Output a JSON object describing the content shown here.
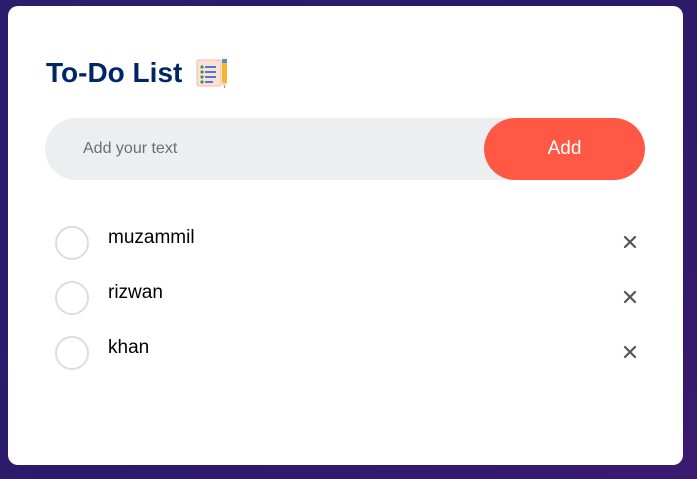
{
  "header": {
    "title": "To-Do List",
    "title_icon": "notepad-pencil-icon"
  },
  "input": {
    "placeholder": "Add your text",
    "value": ""
  },
  "add_button": {
    "label": "Add"
  },
  "tasks": [
    {
      "text": "muzammil",
      "checked": false
    },
    {
      "text": "rizwan",
      "checked": false
    },
    {
      "text": "khan",
      "checked": false
    }
  ],
  "colors": {
    "title": "#002765",
    "accent": "#ff5945",
    "input_bg": "#edeef0",
    "background": "#2b1a6a"
  }
}
